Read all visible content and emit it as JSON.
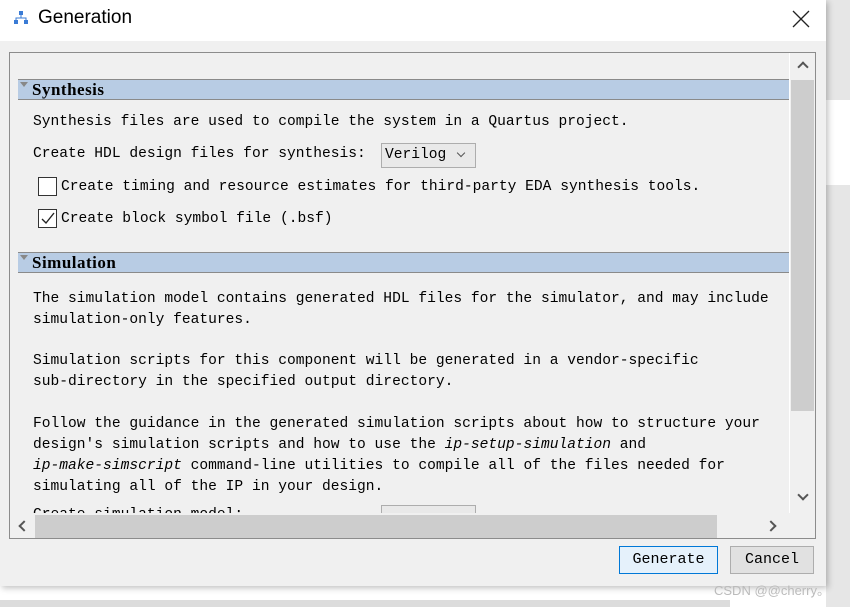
{
  "window": {
    "title": "Generation",
    "icon": "hierarchy-icon"
  },
  "synthesis": {
    "header": "Synthesis",
    "description": "Synthesis files are used to compile the system in a Quartus project.",
    "hdl_label": "Create HDL design files for synthesis:",
    "hdl_value": "Verilog",
    "timing_label": "Create timing and resource estimates for third-party EDA synthesis tools.",
    "timing_checked": false,
    "bsf_label": "Create block symbol file (.bsf)",
    "bsf_checked": true
  },
  "simulation": {
    "header": "Simulation",
    "p1_l1": "The simulation model contains generated HDL files for the simulator, and may include",
    "p1_l2": "simulation-only features.",
    "p2_l1": "Simulation scripts for this component will be generated in a vendor-specific",
    "p2_l2": "sub-directory in the specified output directory.",
    "p3_l1": "Follow the guidance in the generated simulation scripts about how to structure your",
    "p3_l2a": "design's simulation scripts and how to use the ",
    "p3_l2b": "ip-setup-simulation",
    "p3_l2c": " and",
    "p3_l3a": "ip-make-simscript",
    "p3_l3b": " command-line utilities to compile all of the files needed for",
    "p3_l4": "simulating all of the IP in your design.",
    "model_label": "Create simulation model:"
  },
  "buttons": {
    "generate": "Generate",
    "cancel": "Cancel"
  },
  "watermark": "CSDN @@cherry。"
}
